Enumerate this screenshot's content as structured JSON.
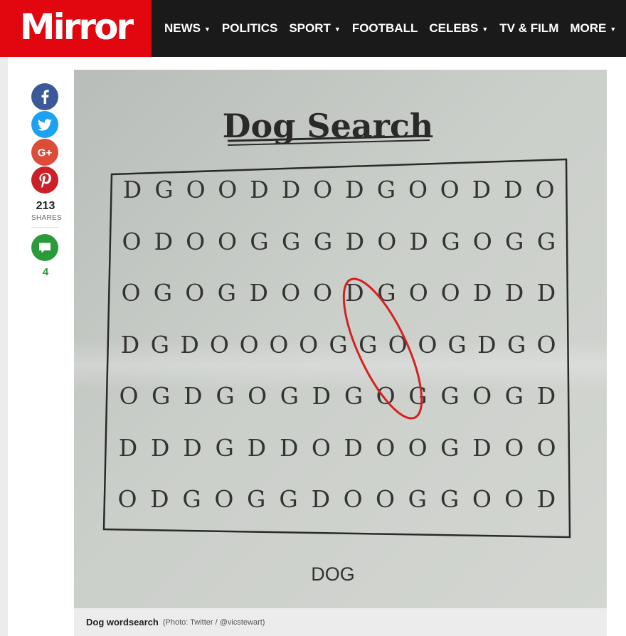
{
  "brand": {
    "logo": "Mirror",
    "accent": "#e2060f",
    "bar": "#1a1a1a"
  },
  "nav": [
    {
      "label": "NEWS",
      "dropdown": true
    },
    {
      "label": "POLITICS",
      "dropdown": false
    },
    {
      "label": "SPORT",
      "dropdown": true
    },
    {
      "label": "FOOTBALL",
      "dropdown": false
    },
    {
      "label": "CELEBS",
      "dropdown": true
    },
    {
      "label": "TV & FILM",
      "dropdown": false
    },
    {
      "label": "MORE",
      "dropdown": true
    }
  ],
  "share": {
    "buttons": [
      {
        "name": "facebook-icon",
        "color": "#3b5998"
      },
      {
        "name": "twitter-icon",
        "color": "#1da1f2"
      },
      {
        "name": "google-plus-icon",
        "color": "#dd4b39"
      },
      {
        "name": "pinterest-icon",
        "color": "#cb2027"
      }
    ],
    "count": "213",
    "count_label": "SHARES",
    "comments_icon": "comment-icon",
    "comments_color": "#2a9a3a",
    "comments_count": "4"
  },
  "puzzle": {
    "title": "Dog Search",
    "grid": [
      "DGOODDODGOODDO",
      "ODOOGGGDODGOGG",
      "OGOGDOODGOODDD",
      "DGDOOOOGGOOGDGO",
      "OGDGOGDGOGGOGD",
      "DDDGDDODOOGDOO",
      "ODGOGGDOOGGOOD"
    ],
    "word": "DOG"
  },
  "caption": {
    "text": "Dog wordsearch",
    "credit": "(Photo: Twitter / @vicstewart)"
  }
}
